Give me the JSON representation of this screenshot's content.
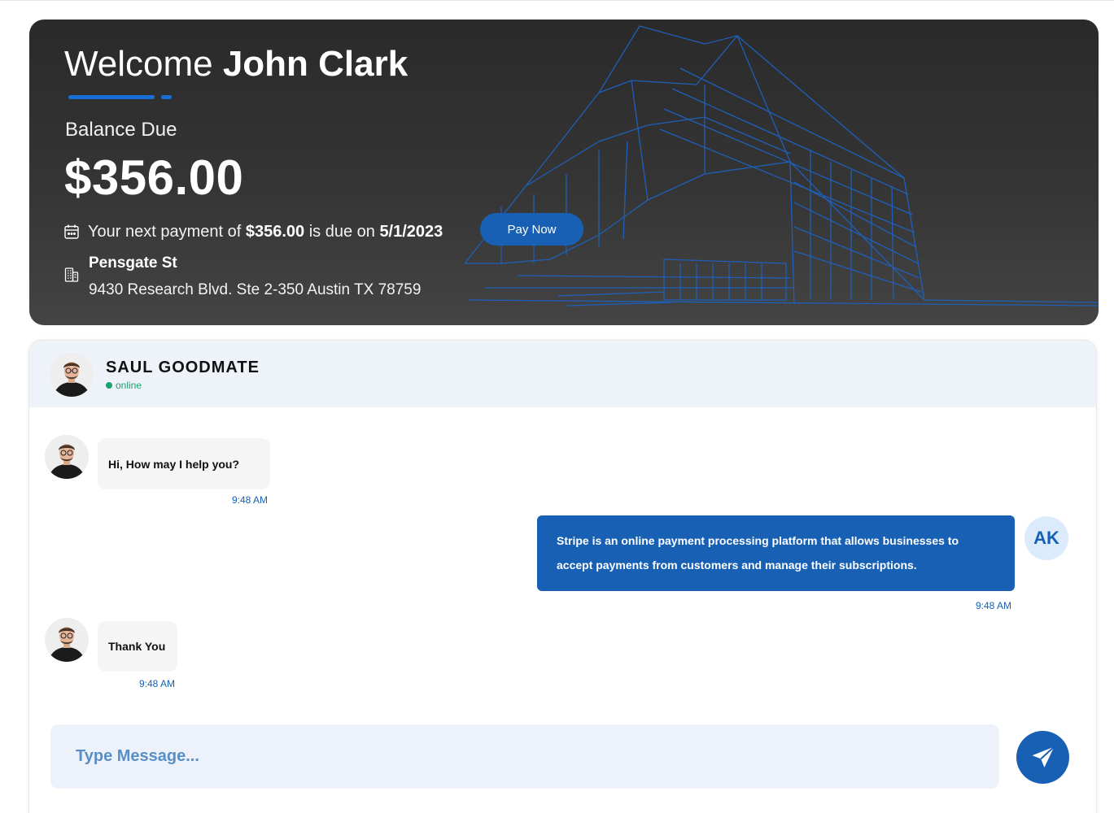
{
  "banner": {
    "welcome_prefix": "Welcome",
    "user_name": "John Clark",
    "balance_label": "Balance Due",
    "balance_amount": "$356.00",
    "due_text_1": "Your next payment of",
    "due_amount": "$356.00",
    "due_text_2": "is due on",
    "due_date": "5/1/2023",
    "pay_button": "Pay Now",
    "property_name": "Pensgate St",
    "property_address": "9430 Research Blvd. Ste 2-350 Austin TX 78759"
  },
  "chat": {
    "contact_name": "SAUL GOODMATE",
    "contact_status": "online",
    "user_initials": "AK",
    "messages": [
      {
        "from": "agent",
        "text": "Hi, How may I help you?",
        "time": "9:48 AM"
      },
      {
        "from": "user",
        "text": "Stripe is an online payment processing platform that allows businesses to accept payments from customers and manage their subscriptions.",
        "time": "9:48 AM"
      },
      {
        "from": "agent",
        "text": "Thank You",
        "time": "9:48 AM"
      }
    ],
    "input_placeholder": "Type Message..."
  },
  "colors": {
    "accent": "#1760b4",
    "online": "#1aa36a",
    "banner_bg": "#333333"
  },
  "icons": [
    "calendar-icon",
    "building-icon",
    "send-icon",
    "avatar-photo"
  ]
}
